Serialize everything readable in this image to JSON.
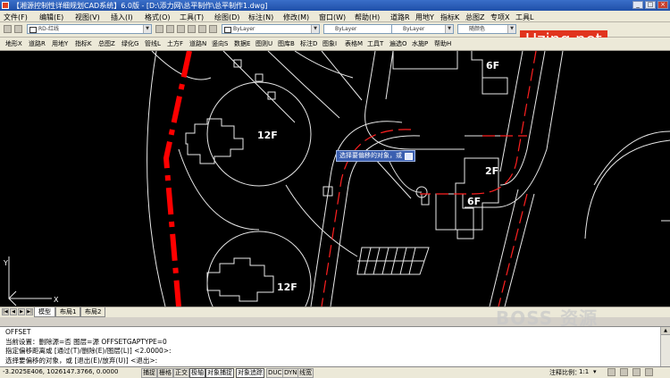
{
  "window": {
    "title": "【湘源控制性详细规划CAD系统】6.0版 - [D:\\添力网\\总平制作\\总平制作1.dwg]",
    "controls": [
      "_",
      "□",
      "×"
    ]
  },
  "menu": [
    "文件(F)",
    "编辑(E)",
    "视图(V)",
    "插入(I)",
    "格式(O)",
    "工具(T)",
    "绘图(D)",
    "标注(N)",
    "修改(M)",
    "窗口(W)",
    "帮助(H)",
    "道路R",
    "用地Y",
    "指标K",
    "总图Z",
    "专项X",
    "工具L"
  ],
  "toolbar": {
    "layer_name": "RD-红线",
    "color_combo": "ByLayer",
    "linetype_combo": "ByLayer",
    "lineweight_combo": "ByLayer",
    "plotstyle_combo": "随颜色"
  },
  "quick_menu": [
    "地形X",
    "道路R",
    "用地Y",
    "指标K",
    "总图Z",
    "绿化G",
    "管线L",
    "土方F",
    "道路N",
    "竖向S",
    "数据E",
    "图则U",
    "图库B",
    "标注D",
    "图象I",
    "表格M",
    "工具T",
    "遍选O",
    "水施P",
    "帮助H"
  ],
  "drawing": {
    "building_labels": [
      "12F",
      "6F",
      "2F",
      "6F",
      "12F"
    ],
    "tooltip": "选择要偏移的对象，或",
    "colors": {
      "background": "#000000",
      "lines": "#ffffff",
      "red_line": "#ff0000",
      "road_center": "#ff2020"
    }
  },
  "watermark": {
    "brand": "Uzing.net",
    "brand_bg": "#e1341e",
    "boss": "BOSS 资源"
  },
  "layout_tabs": [
    "模型",
    "布局1",
    "布局2"
  ],
  "command": {
    "lines": [
      "OFFSET",
      "当前设置：删除源=否  图层=源  OFFSETGAPTYPE=0",
      "指定偏移距离或 [通过(T)/删除(E)/图层(L)] <2.0000>:",
      "选择要偏移的对象，或 [退出(E)/放弃(U)] <退出>:"
    ]
  },
  "status": {
    "coords": "-3.2025E406, 1026147.3766, 0.0000",
    "toggles": [
      "捕捉",
      "栅格",
      "正交",
      "极轴",
      "对象捕捉",
      "对象追踪",
      "DUCS",
      "DYN",
      "线宽"
    ],
    "annotation_scale_label": "注释比例：",
    "annotation_scale": "1:1"
  }
}
